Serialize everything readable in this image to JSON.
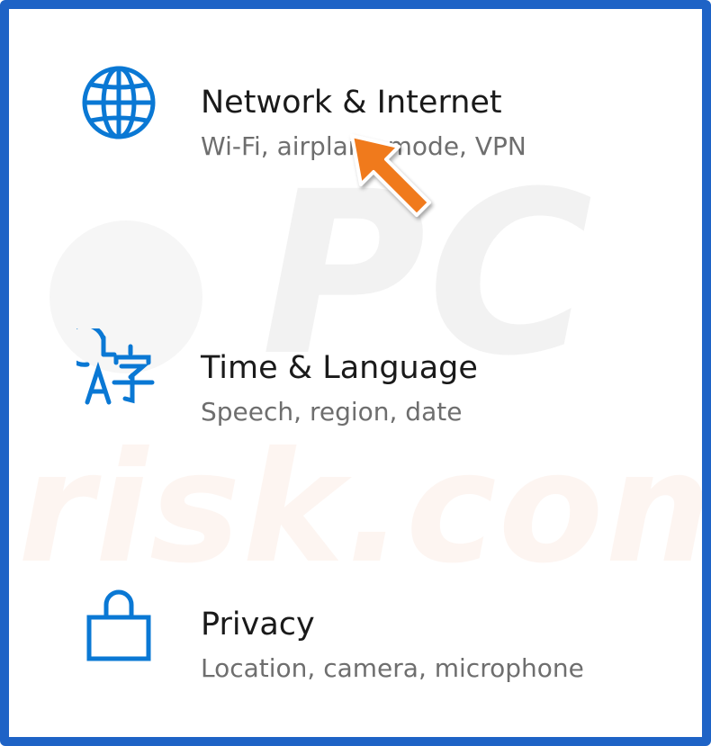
{
  "settings": {
    "items": [
      {
        "title": "Network & Internet",
        "subtitle": "Wi-Fi, airplane mode, VPN",
        "icon": "globe-icon"
      },
      {
        "title": "Time & Language",
        "subtitle": "Speech, region, date",
        "icon": "time-language-icon"
      },
      {
        "title": "Privacy",
        "subtitle": "Location, camera, microphone",
        "icon": "lock-icon"
      }
    ]
  },
  "annotation": {
    "icon": "pointer-arrow-icon",
    "color": "#f07a1f"
  },
  "watermark": {
    "text_top": "PC",
    "text_bottom": "risk.com"
  },
  "colors": {
    "frame_border": "#1e63c6",
    "icon_blue": "#0a78d4",
    "title_text": "#1a1a1a",
    "subtitle_text": "#6e6e6e"
  }
}
